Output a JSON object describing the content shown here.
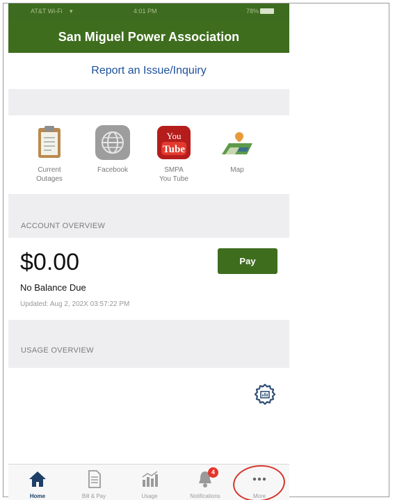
{
  "status_bar": {
    "carrier": "AT&T Wi-Fi",
    "time": "4:01 PM",
    "battery": "78%"
  },
  "header": {
    "title": "San Miguel Power Association"
  },
  "report_link": {
    "label": "Report an Issue/Inquiry"
  },
  "quick_links": [
    {
      "label": "Current Outages",
      "icon": "clipboard-icon"
    },
    {
      "label": "Facebook",
      "icon": "globe-icon"
    },
    {
      "label": "SMPA You Tube",
      "icon": "youtube-icon"
    },
    {
      "label": "Map",
      "icon": "map-icon"
    }
  ],
  "account": {
    "section_title": "ACCOUNT OVERVIEW",
    "balance": "$0.00",
    "status": "No Balance Due",
    "updated": "Updated: Aug 2, 202X 03:57:22 PM",
    "pay_label": "Pay"
  },
  "usage": {
    "section_title": "USAGE OVERVIEW"
  },
  "tabs": [
    {
      "label": "Home",
      "icon": "home-icon"
    },
    {
      "label": "Bill & Pay",
      "icon": "bill-icon"
    },
    {
      "label": "Usage",
      "icon": "usage-chart-icon"
    },
    {
      "label": "Notifications",
      "icon": "bell-icon",
      "badge": "4"
    },
    {
      "label": "More",
      "icon": "more-dots-icon"
    }
  ],
  "colors": {
    "brand_green": "#3e6d1e",
    "link_blue": "#1d4f9a",
    "annotation_red": "#d5342c",
    "active_tab": "#1e3f68"
  }
}
